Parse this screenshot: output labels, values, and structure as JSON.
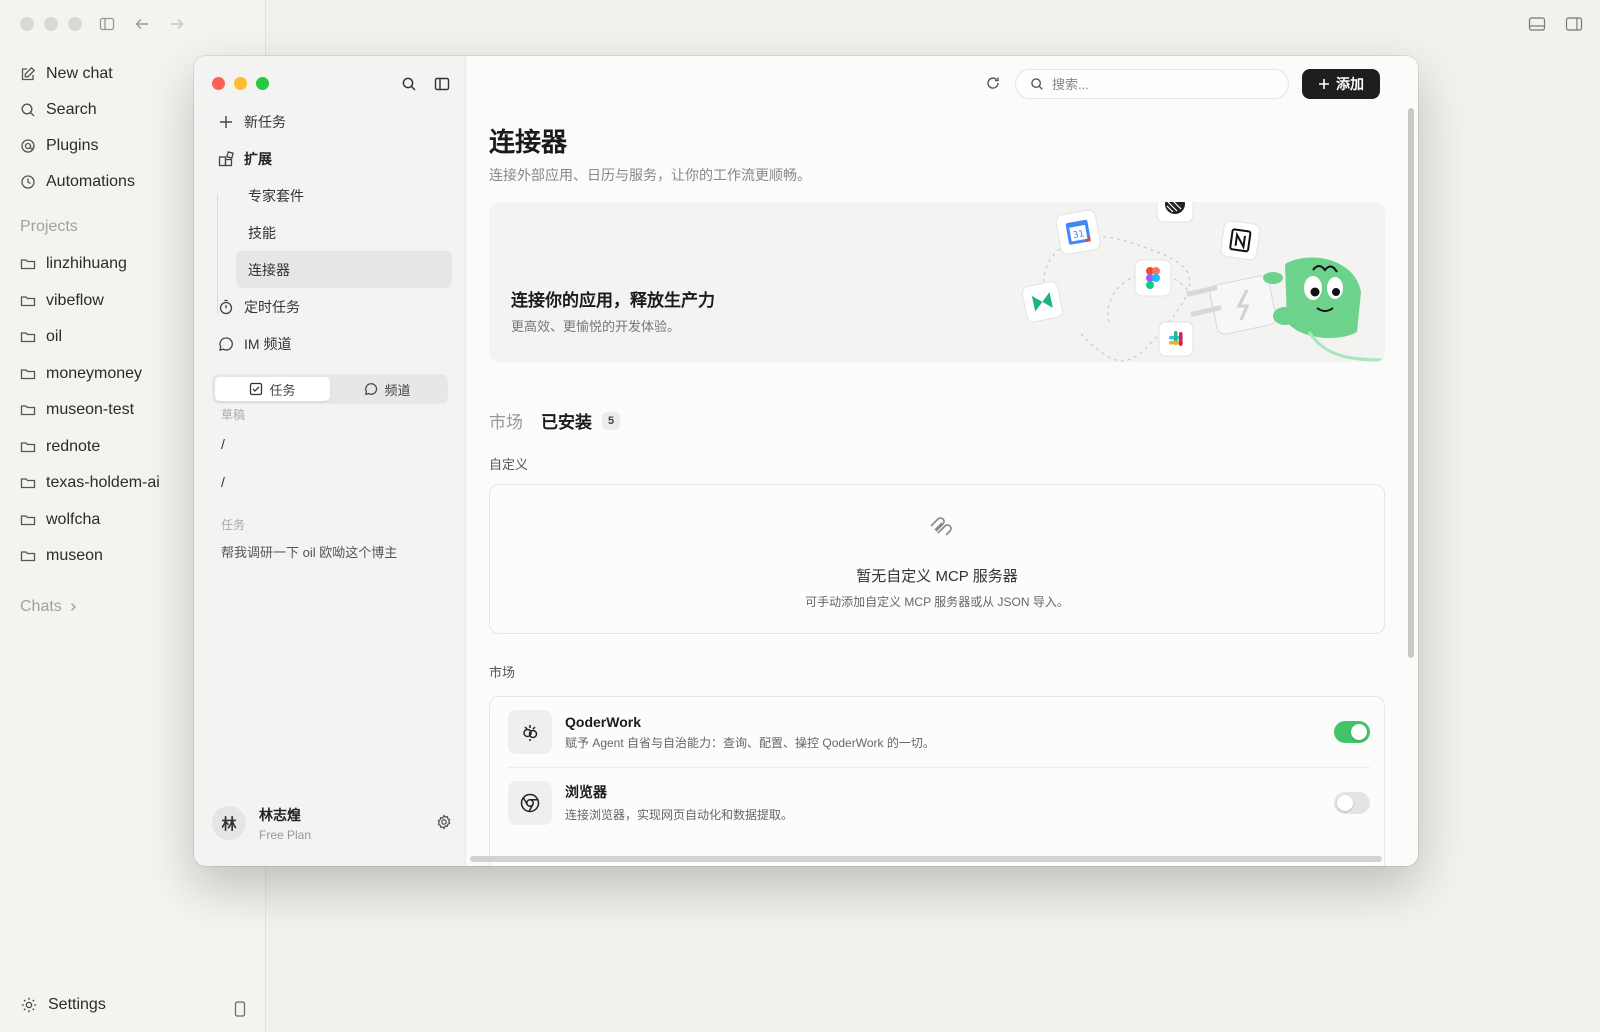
{
  "back_app": {
    "nav": [
      {
        "label": "New chat",
        "icon": "compose-icon"
      },
      {
        "label": "Search",
        "icon": "search-icon"
      },
      {
        "label": "Plugins",
        "icon": "plugin-icon"
      },
      {
        "label": "Automations",
        "icon": "clock-icon"
      }
    ],
    "projects_label": "Projects",
    "projects": [
      "linzhihuang",
      "vibeflow",
      "oil",
      "moneymoney",
      "museon-test",
      "rednote",
      "texas-holdem-ai",
      "wolfcha",
      "museon"
    ],
    "chats_label": "Chats",
    "settings_label": "Settings"
  },
  "sidebar": {
    "new_task": "新任务",
    "extensions": "扩展",
    "sub_items": [
      "专家套件",
      "技能",
      "连接器"
    ],
    "scheduled": "定时任务",
    "im_channel": "IM 频道",
    "segment": {
      "tasks": "任务",
      "channels": "频道"
    },
    "drafts_label": "草稿",
    "drafts": [
      "/",
      "/"
    ],
    "tasks_label": "任务",
    "tasks": [
      "帮我调研一下 oil 欧呦这个博主"
    ],
    "user": {
      "initial": "林",
      "name": "林志煌",
      "plan": "Free Plan"
    }
  },
  "topbar": {
    "search_placeholder": "搜索...",
    "add_label": "添加"
  },
  "page": {
    "title": "连接器",
    "subtitle": "连接外部应用、日历与服务，让你的工作流更顺畅。",
    "banner_title": "连接你的应用，释放生产力",
    "banner_sub": "更高效、更愉悦的开发体验。",
    "tabs": [
      {
        "label": "市场",
        "active": false
      },
      {
        "label": "已安装",
        "active": true,
        "count": "5"
      }
    ],
    "custom_label": "自定义",
    "empty_title": "暂无自定义 MCP 服务器",
    "empty_sub": "可手动添加自定义 MCP 服务器或从 JSON 导入。",
    "market_label": "市场",
    "market": [
      {
        "name": "QoderWork",
        "desc": "赋予 Agent 自省与自治能力：查询、配置、操控 QoderWork 的一切。",
        "enabled": true,
        "icon": "qoderwork-icon"
      },
      {
        "name": "浏览器",
        "desc": "连接浏览器，实现网页自动化和数据提取。",
        "enabled": false,
        "icon": "chrome-icon"
      }
    ]
  },
  "colors": {
    "toggle_on": "#43c46b",
    "toggle_off": "#e4e4e2",
    "traffic_red": "#ff5f57",
    "traffic_yellow": "#febc2e",
    "traffic_green": "#28c840"
  }
}
